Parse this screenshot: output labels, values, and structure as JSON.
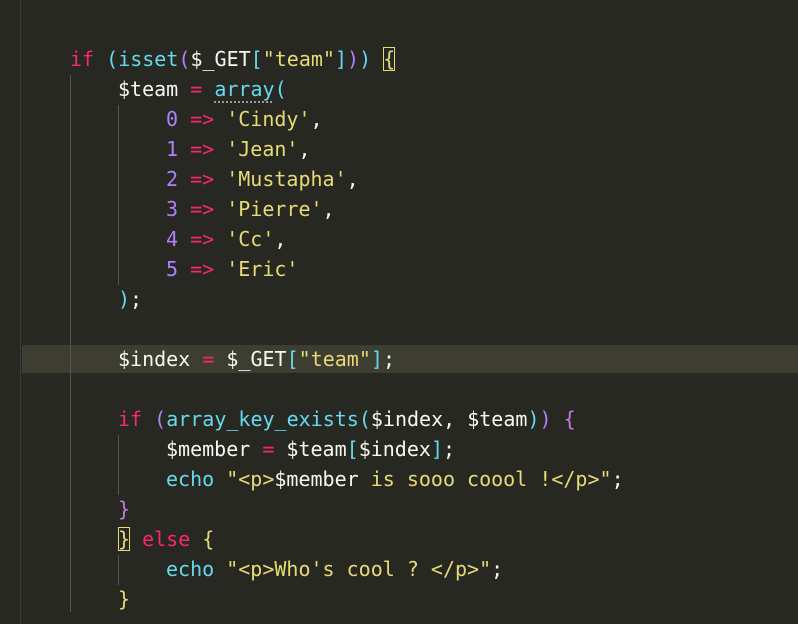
{
  "editor": {
    "colors": {
      "background": "#272822",
      "current_line": "#3e3d32",
      "keyword": "#f92672",
      "function": "#66d9ef",
      "string": "#e6db74",
      "number": "#ae81ff",
      "text": "#f8f8f2"
    },
    "lines": {
      "l1": {
        "kw": "if",
        "p_open": " (",
        "fn": "isset",
        "p2_open": "(",
        "var": "$_GET",
        "br_open": "[",
        "str": "\"team\"",
        "br_close": "]",
        "p2_close": ")",
        "p_close": ")",
        "sp": " ",
        "brace": "{"
      },
      "l2": {
        "var": "$team",
        "op": " = ",
        "fn": "array",
        "paren": "("
      },
      "l3": {
        "num": "0",
        "arrow": " => ",
        "str": "'Cindy'",
        "comma": ","
      },
      "l4": {
        "num": "1",
        "arrow": " => ",
        "str": "'Jean'",
        "comma": ","
      },
      "l5": {
        "num": "2",
        "arrow": " => ",
        "str": "'Mustapha'",
        "comma": ","
      },
      "l6": {
        "num": "3",
        "arrow": " => ",
        "str": "'Pierre'",
        "comma": ","
      },
      "l7": {
        "num": "4",
        "arrow": " => ",
        "str": "'Cc'",
        "comma": ","
      },
      "l8": {
        "num": "5",
        "arrow": " => ",
        "str": "'Eric'"
      },
      "l9": {
        "paren": ")",
        "semi": ";"
      },
      "l11": {
        "var": "$index",
        "op": " = ",
        "var2": "$_GET",
        "br_open": "[",
        "str": "\"team\"",
        "br_close": "]",
        "semi": ";"
      },
      "l13": {
        "kw": "if",
        "p_open": " (",
        "fn": "array_key_exists",
        "p2_open": "(",
        "args": "$index, $team",
        "p2_close": ")",
        "p_close": ")",
        "sp": " ",
        "brace": "{"
      },
      "l14": {
        "var": "$member",
        "op": " = ",
        "var2": "$team",
        "br_open": "[",
        "var3": "$index",
        "br_close": "]",
        "semi": ";"
      },
      "l15": {
        "fn": "echo",
        "sp": " ",
        "str_open": "\"<p>",
        "var": "$member",
        "str_close": " is sooo coool !</p>\"",
        "semi": ";"
      },
      "l16": {
        "brace": "}"
      },
      "l17": {
        "brace": "}",
        "kw": " else ",
        "brace2": "{"
      },
      "l18": {
        "fn": "echo",
        "sp": " ",
        "str": "\"<p>Who's cool ? </p>\"",
        "semi": ";"
      },
      "l19": {
        "brace": "}"
      }
    }
  }
}
